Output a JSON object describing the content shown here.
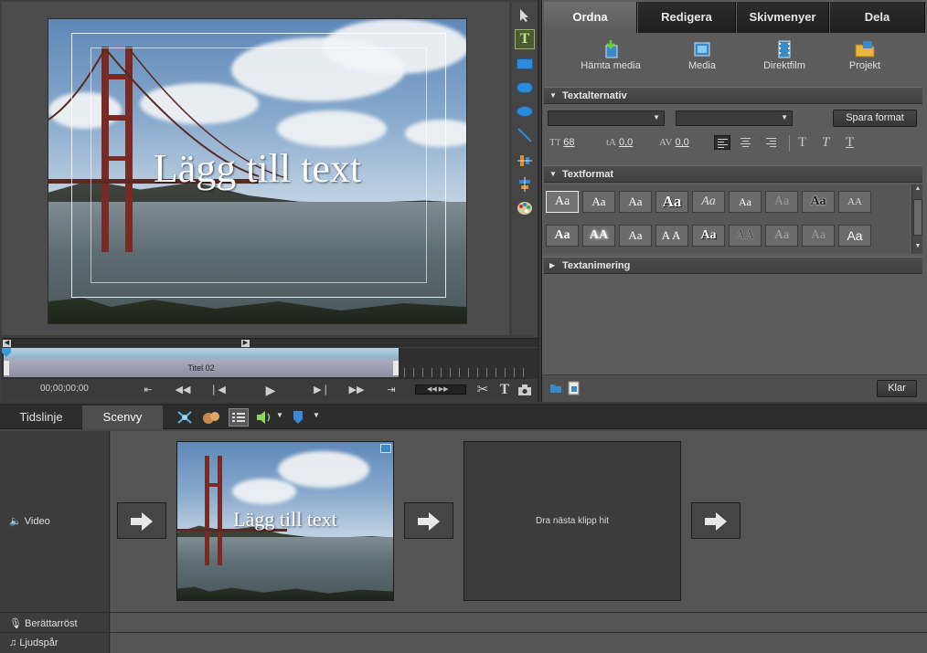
{
  "monitor": {
    "title_overlay": "Lägg till text",
    "clip_title": "Titel 02",
    "timecode": "00;00;00;00"
  },
  "tools": [
    {
      "name": "selection-tool",
      "icon": "arrow-pointer-icon"
    },
    {
      "name": "text-tool",
      "icon": "text-t-icon"
    },
    {
      "name": "rectangle-tool",
      "icon": "rectangle-icon"
    },
    {
      "name": "rounded-rect-tool",
      "icon": "rounded-rectangle-icon"
    },
    {
      "name": "ellipse-tool",
      "icon": "ellipse-icon"
    },
    {
      "name": "line-tool",
      "icon": "line-icon"
    },
    {
      "name": "align-tool",
      "icon": "align-icon"
    },
    {
      "name": "distribute-tool",
      "icon": "distribute-icon"
    },
    {
      "name": "color-tool",
      "icon": "palette-icon"
    }
  ],
  "tabs": [
    {
      "label": "Ordna",
      "active": true
    },
    {
      "label": "Redigera",
      "active": false
    },
    {
      "label": "Skivmenyer",
      "active": false
    },
    {
      "label": "Dela",
      "active": false
    }
  ],
  "actions": [
    {
      "label": "Hämta media",
      "icon": "get-media-icon"
    },
    {
      "label": "Media",
      "icon": "media-icon"
    },
    {
      "label": "Direktfilm",
      "icon": "instant-movie-icon"
    },
    {
      "label": "Projekt",
      "icon": "project-folder-icon"
    }
  ],
  "text_options": {
    "header": "Textalternativ",
    "font_value": "",
    "style_value": "",
    "save_style_label": "Spara format",
    "font_size": "68",
    "leading": "0,0",
    "kerning": "0,0"
  },
  "text_styles": {
    "header": "Textformat",
    "sample": "Aa",
    "sample_caps": "AA"
  },
  "text_animation": {
    "header": "Textanimering"
  },
  "panel_footer": {
    "done_label": "Klar"
  },
  "sceneline": {
    "tabs": [
      {
        "label": "Tidslinje",
        "active": false
      },
      {
        "label": "Scenvy",
        "active": true
      }
    ],
    "tracks": {
      "video": "Video",
      "narration": "Berättarröst",
      "soundtrack": "Ljudspår"
    },
    "clip_title": "Lägg till text",
    "drop_hint": "Dra nästa klipp hit"
  },
  "colors": {
    "accent_active_tab": "#5c5c5c",
    "panel_bg": "#484848",
    "dark_bg": "#2d2d2d"
  }
}
